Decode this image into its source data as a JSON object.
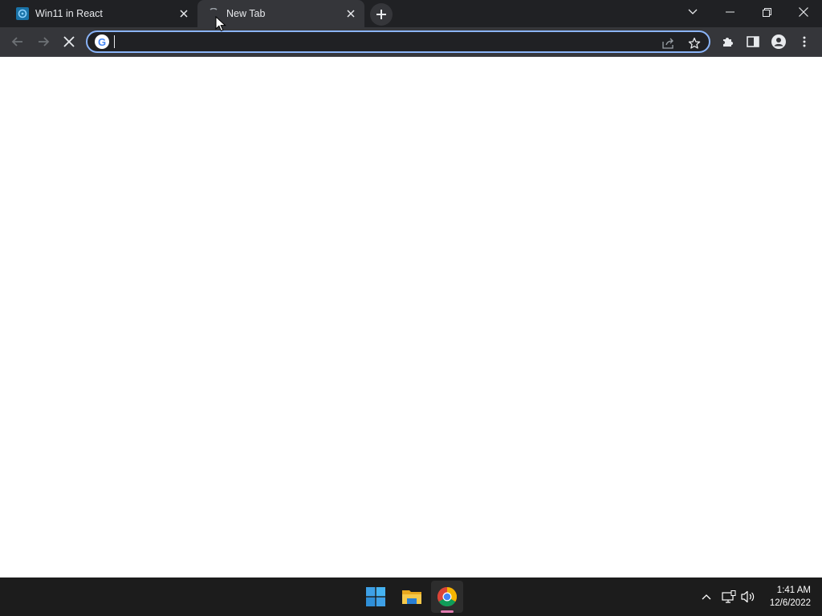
{
  "browser": {
    "tabs": [
      {
        "title": "Win11 in React",
        "favicon": "win11-react-icon",
        "active": false
      },
      {
        "title": "New Tab",
        "favicon": "loading-icon",
        "active": true
      }
    ],
    "new_tab_icon": "plus-icon",
    "window_controls": [
      "tab-search-icon",
      "minimize-icon",
      "restore-icon",
      "close-icon"
    ],
    "omnibox": {
      "value": "",
      "placeholder": "",
      "search_engine_icon": "google-g-icon",
      "google_letter": "G"
    },
    "toolbar_icons": [
      "back-icon",
      "forward-icon",
      "stop-loading-icon",
      "share-icon",
      "bookmark-star-icon",
      "extensions-icon",
      "side-panel-icon",
      "profile-icon",
      "menu-kebab-icon"
    ]
  },
  "taskbar": {
    "apps": [
      "start-windows-icon",
      "file-explorer-icon",
      "chrome-icon"
    ],
    "tray_icons": [
      "show-hidden-icons-chevron-icon",
      "network-icon",
      "volume-icon"
    ],
    "clock": {
      "time": "1:41 AM",
      "date": "12/6/2022"
    },
    "chrome_indicator_color": "#e07bb0"
  },
  "colors": {
    "omnibox_focus_ring": "#8ab4f8",
    "tab_strip_bg": "#202124",
    "toolbar_bg": "#35363a",
    "taskbar_bg": "#1c1c1c"
  }
}
